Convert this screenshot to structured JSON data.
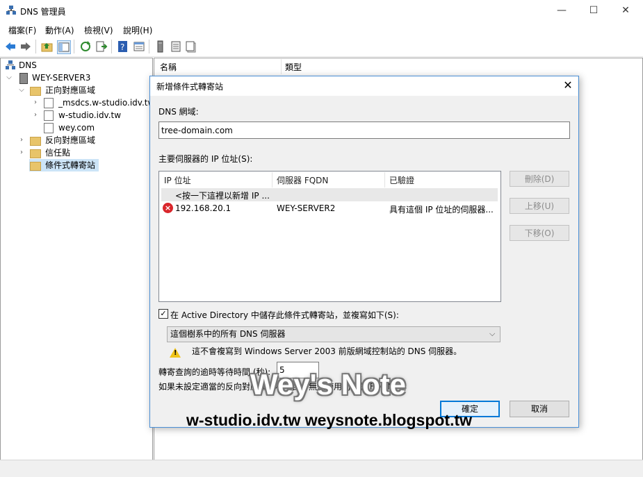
{
  "window": {
    "title": "DNS 管理員",
    "icon": "dns-manager-icon",
    "minimize": "—",
    "maximize": "☐",
    "close": "✕"
  },
  "menu": [
    "檔案(F)",
    "動作(A)",
    "檢視(V)",
    "說明(H)"
  ],
  "toolbar": [
    "back-icon",
    "forward-icon",
    "up-folder-icon",
    "show-hide-console-tree-icon",
    "refresh-icon",
    "export-list-icon",
    "help-icon",
    "properties-icon",
    "server-icon",
    "zone-list-icon",
    "records-icon"
  ],
  "tree": {
    "root": "DNS",
    "server": "WEY-SERVER3",
    "forward_zones": "正向對應區域",
    "zone1": "_msdcs.w-studio.idv.tw",
    "zone2": "w-studio.idv.tw",
    "zone3": "wey.com",
    "reverse_zones": "反向對應區域",
    "trust_points": "信任點",
    "conditional_forwarders": "條件式轉寄站"
  },
  "columns": {
    "name": "名稱",
    "type": "類型"
  },
  "dialog": {
    "title": "新增條件式轉寄站",
    "close": "✕",
    "dns_domain_label": "DNS 網域:",
    "dns_domain_value": "tree-domain.com",
    "primary_servers_label": "主要伺服器的 IP 位址(S):",
    "list_headers": {
      "ip": "IP 位址",
      "fqdn": "伺服器 FQDN",
      "validated": "已驗證"
    },
    "add_row_hint": "<按一下這裡以新增 IP ...",
    "rows": [
      {
        "ip": "192.168.20.1",
        "fqdn": "WEY-SERVER2",
        "validated": "具有這個 IP 位址的伺服器..."
      }
    ],
    "delete_button": "刪除(D)",
    "up_button": "上移(U)",
    "down_button": "下移(O)",
    "store_in_ad_checked": true,
    "store_in_ad_label": "在 Active Directory 中儲存此條件式轉寄站，並複寫如下(S):",
    "replication_scope": "這個樹系中的所有 DNS 伺服器",
    "warning_text": "這不會複寫到 Windows Server 2003 前版網域控制站的 DNS 伺服器。",
    "timeout_label": "轉寄查詢的逾時等待時間 (秒):",
    "timeout_value": "5",
    "reverse_note": "如果未設定適當的反向對應區域和項目，無法使用伺服器 FQDN。",
    "ok_button": "確定",
    "cancel_button": "取消"
  },
  "watermark": {
    "brand": "Wey's Note",
    "urls": "w-studio.idv.tw  weysnote.blogspot.tw"
  }
}
